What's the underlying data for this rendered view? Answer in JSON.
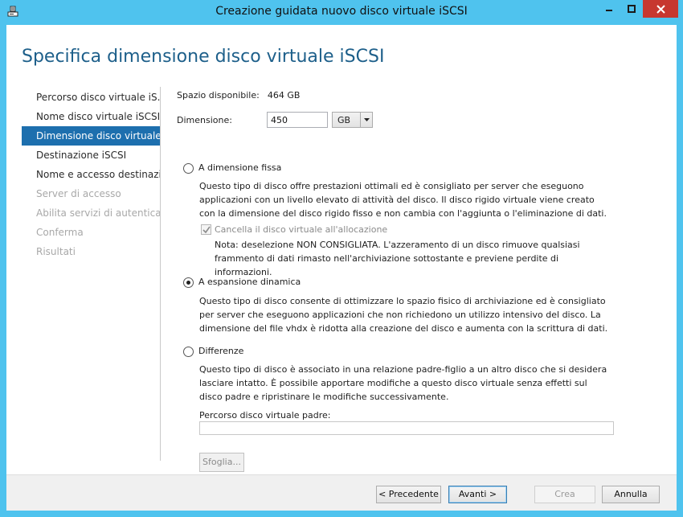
{
  "window": {
    "title": "Creazione guidata nuovo disco virtuale iSCSI",
    "icon": "wizard-app-icon"
  },
  "page_title": "Specifica dimensione disco virtuale iSCSI",
  "nav": {
    "items": [
      {
        "label": "Percorso disco virtuale iS...",
        "state": "normal"
      },
      {
        "label": "Nome disco virtuale iSCSI",
        "state": "normal"
      },
      {
        "label": "Dimensione disco virtuale...",
        "state": "active"
      },
      {
        "label": "Destinazione iSCSI",
        "state": "normal"
      },
      {
        "label": "Nome e accesso destinazi...",
        "state": "normal"
      },
      {
        "label": "Server di accesso",
        "state": "disabled"
      },
      {
        "label": "Abilita servizi di autentica...",
        "state": "disabled"
      },
      {
        "label": "Conferma",
        "state": "disabled"
      },
      {
        "label": "Risultati",
        "state": "disabled"
      }
    ]
  },
  "space": {
    "label": "Spazio disponibile:",
    "value": "464 GB"
  },
  "size": {
    "label": "Dimensione:",
    "value": "450",
    "unit": "GB"
  },
  "options": {
    "fixed": {
      "label": "A dimensione fissa",
      "selected": false,
      "description": "Questo tipo di disco offre prestazioni ottimali ed è consigliato per server che eseguono applicazioni con un livello elevato di attività del disco. Il disco rigido virtuale viene creato con la dimensione del disco rigido fisso e non cambia con l'aggiunta o l'eliminazione di dati.",
      "clear_checkbox": {
        "label": "Cancella il disco virtuale all'allocazione",
        "checked": true,
        "enabled": false
      },
      "note": "Nota: deselezione NON CONSIGLIATA. L'azzeramento di un disco rimuove qualsiasi frammento di dati rimasto nell'archiviazione sottostante e previene perdite di informazioni."
    },
    "dynamic": {
      "label": "A espansione dinamica",
      "selected": true,
      "description": "Questo tipo di disco consente di ottimizzare lo spazio fisico di archiviazione ed è consigliato per server che eseguono applicazioni che non richiedono un utilizzo intensivo del disco. La dimensione del file vhdx è ridotta alla creazione del disco e aumenta con la scrittura di dati."
    },
    "differencing": {
      "label": "Differenze",
      "selected": false,
      "description": "Questo tipo di disco è associato in una relazione padre-figlio a un altro disco che si desidera lasciare intatto. È possibile apportare modifiche a questo disco virtuale senza effetti sul disco padre e ripristinare le modifiche successivamente.",
      "parent_path_label": "Percorso disco virtuale padre:",
      "parent_path_value": "",
      "browse_label": "Sfoglia..."
    }
  },
  "footer": {
    "previous": "< Precedente",
    "next": "Avanti >",
    "create": "Crea",
    "cancel": "Annulla"
  },
  "colors": {
    "title_bar": "#4fc3ee",
    "accent": "#1d6fae",
    "heading": "#1d5f8a",
    "close": "#c7372f"
  }
}
